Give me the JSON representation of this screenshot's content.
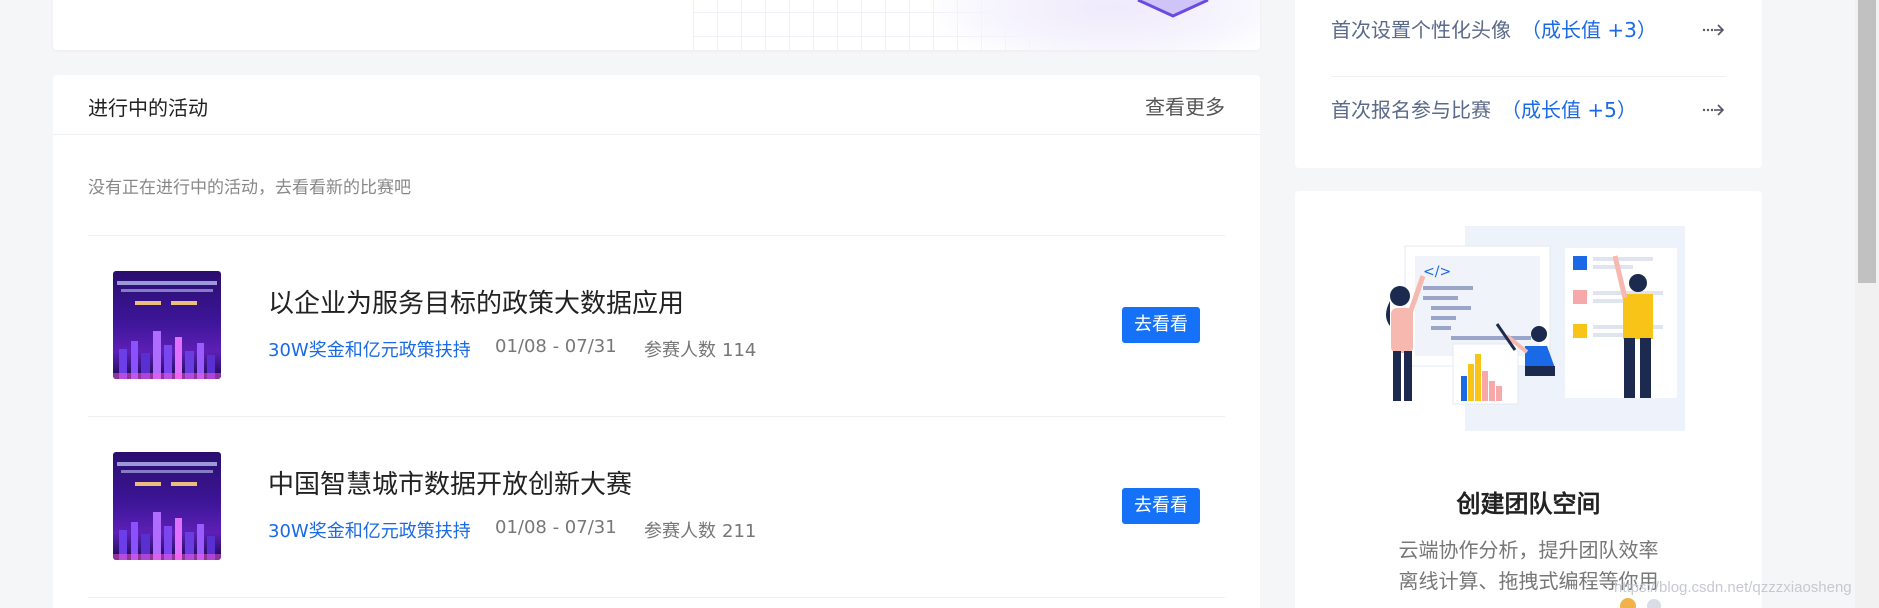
{
  "activities": {
    "title": "进行中的活动",
    "more_label": "查看更多",
    "empty_text": "没有正在进行中的活动，去看看新的比赛吧",
    "items": [
      {
        "name": "以企业为服务目标的政策大数据应用",
        "prize": "30W奖金和亿元政策扶持",
        "dates": "01/08 - 07/31",
        "count_label": "参赛人数",
        "count": "114",
        "button": "去看看"
      },
      {
        "name": "中国智慧城市数据开放创新大赛",
        "prize": "30W奖金和亿元政策扶持",
        "dates": "01/08 - 07/31",
        "count_label": "参赛人数",
        "count": "211",
        "button": "去看看"
      }
    ]
  },
  "tasks": [
    {
      "label": "首次设置个性化头像",
      "bonus": "（成长值 +3）"
    },
    {
      "label": "首次报名参与比赛",
      "bonus": "（成长值 +5）"
    }
  ],
  "team": {
    "title": "创建团队空间",
    "desc_line1": "云端协作分析，提升团队效率",
    "desc_line2": "离线计算、拖拽式编程等你用"
  },
  "watermark": "https://blog.csdn.net/qzzzxiaosheng",
  "colors": {
    "accent": "#1571f8",
    "link": "#1a6ae8",
    "page_bg": "#f5f6f7"
  }
}
